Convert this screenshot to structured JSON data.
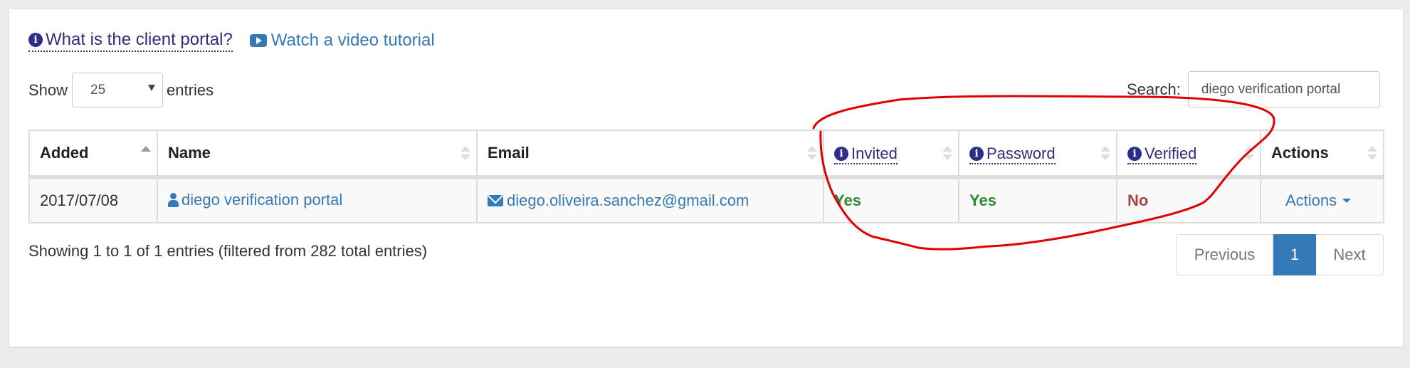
{
  "links": {
    "help": {
      "icon": "info-icon",
      "label": "What is the client portal?"
    },
    "video": {
      "icon": "youtube-play-icon",
      "label": "Watch a video tutorial"
    }
  },
  "length_menu": {
    "prefix": "Show",
    "selected": "25",
    "suffix": "entries"
  },
  "search": {
    "label": "Search:",
    "value": "diego verification portal"
  },
  "table": {
    "columns": [
      {
        "label": "Added",
        "sort": "ascending"
      },
      {
        "label": "Name",
        "sort": "none"
      },
      {
        "label": "Email",
        "sort": "none"
      },
      {
        "label": "Invited",
        "sort": "none",
        "help_icon": "info-icon"
      },
      {
        "label": "Password",
        "sort": "none",
        "help_icon": "info-icon"
      },
      {
        "label": "Verified",
        "sort": "none",
        "help_icon": "info-icon"
      },
      {
        "label": "Actions",
        "sort": "none"
      }
    ],
    "rows": [
      {
        "added": "2017/07/08",
        "name": "diego verification portal",
        "email": "diego.oliveira.sanchez@gmail.com",
        "invited": "Yes",
        "password": "Yes",
        "verified": "No",
        "actions": "Actions"
      }
    ]
  },
  "info": "Showing 1 to 1 of 1 entries (filtered from 282 total entries)",
  "pagination": {
    "previous": "Previous",
    "current": "1",
    "next": "Next"
  },
  "colors": {
    "link": "#337ab7",
    "help_link": "#2e2d7e",
    "yes": "#2d8a2d",
    "no": "#a94442",
    "annotation": "#e00000"
  }
}
